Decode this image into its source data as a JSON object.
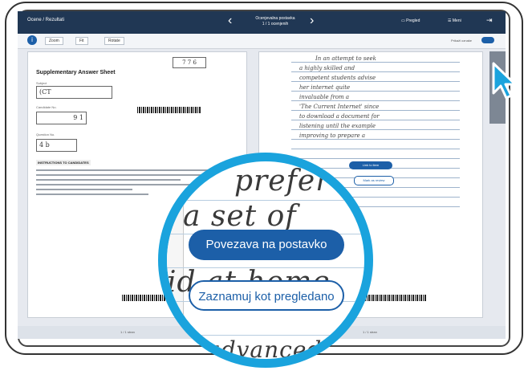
{
  "topbar": {
    "app_name": "Ocene / Rezultati",
    "item_line1": "Ocenjevalna postavka",
    "item_line2": "1 / 1 ocenjenih",
    "btn_review": "Pregled",
    "btn_menu": "Meni"
  },
  "subbar": {
    "tab1": "Zoom",
    "tab2": "Fit",
    "tab3": "Rotate",
    "toggle_label": "Prikaži oznake"
  },
  "left_doc": {
    "title": "Supplementary Answer Sheet",
    "field1_label": "Subject",
    "field1_value": "(CT",
    "field2_label": "Candidate No.",
    "field2_value": "9 1",
    "field3_label": "Question No.",
    "field3_value": "4 b",
    "instruction_heading": "INSTRUCTIONS TO CANDIDATES",
    "box_top": "7 7 6"
  },
  "right_doc": {
    "lines": [
      "In an attempt to seek",
      "a highly skilled and",
      "competent students advise",
      "her internet quite",
      "invaluable from a",
      "'The Current Internet' since",
      "to download a document for",
      "listening until the example",
      "improving to prepare a",
      "prefer",
      "a set of",
      "and a home",
      "advanced"
    ],
    "pill_link": "Link to item",
    "pill_mark": "Mark as review"
  },
  "lens": {
    "hw_word1": "prefer",
    "hw_word2": "a  set  of",
    "hw_word3": "id  at  home",
    "hw_word4": "advanced",
    "btn_link": "Povezava na postavko",
    "btn_review": "Zaznamuj kot pregledano"
  },
  "bottombar": {
    "left_text": "1 / 1 stran",
    "right_text": "1 / 1 stran"
  },
  "colors": {
    "accent": "#1c5fa8",
    "lens_ring": "#1aa3dd",
    "topbar": "#203754"
  }
}
